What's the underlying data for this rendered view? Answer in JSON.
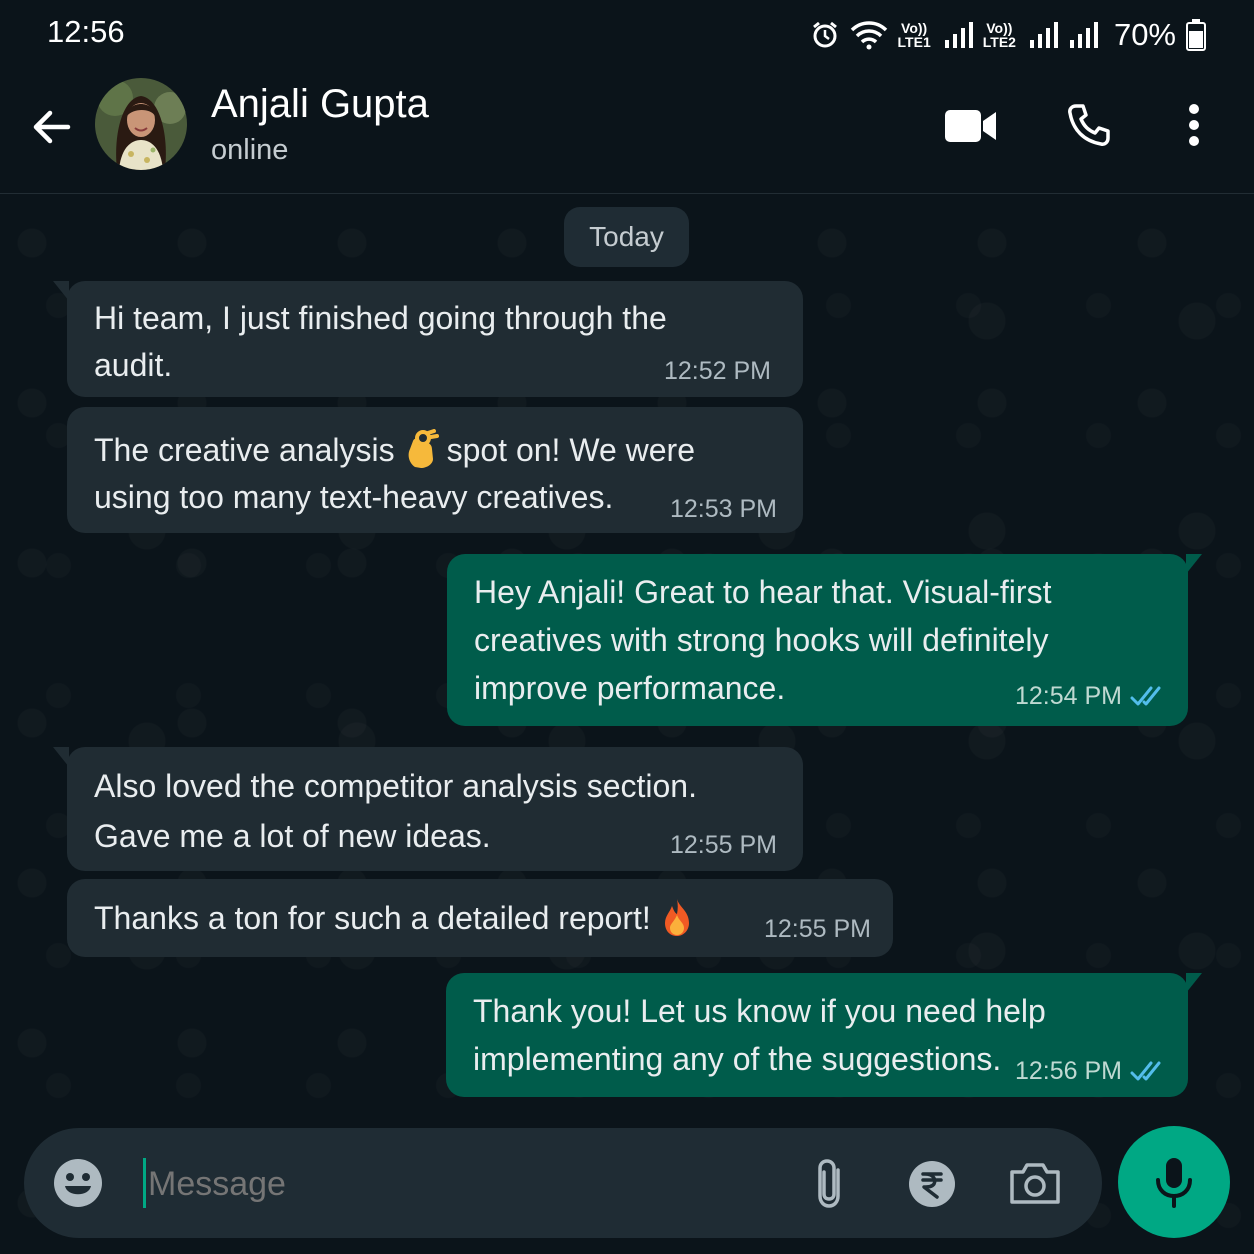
{
  "status_bar": {
    "time": "12:56",
    "net1": {
      "top": "Vo))",
      "bottom": "LTE1"
    },
    "net2": {
      "top": "Vo))",
      "bottom": "LTE2"
    },
    "battery": "70%",
    "icons": [
      "alarm-icon",
      "wifi-icon",
      "signal-icon",
      "signal-icon",
      "signal-icon",
      "battery-icon"
    ]
  },
  "header": {
    "contact_name": "Anjali Gupta",
    "status": "online",
    "icons": [
      "back-arrow-icon",
      "video-call-icon",
      "voice-call-icon",
      "more-options-icon"
    ]
  },
  "chat": {
    "date_divider": "Today",
    "messages": [
      {
        "direction": "incoming",
        "lines": [
          "Hi team, I just finished going through the",
          "audit."
        ],
        "time": "12:52 PM"
      },
      {
        "direction": "incoming",
        "line1_before": "The creative analysis",
        "line1_emoji": "ok-hand",
        "line1_after": "spot on! We were",
        "line2": "using too many text-heavy creatives.",
        "time": "12:53 PM"
      },
      {
        "direction": "outgoing",
        "lines": [
          "Hey Anjali! Great to hear that. Visual-first",
          "creatives with strong hooks will definitely",
          "improve performance."
        ],
        "time": "12:54 PM",
        "read": true
      },
      {
        "direction": "incoming",
        "lines": [
          "Also loved the competitor analysis section.",
          "Gave me a lot of new ideas."
        ],
        "time": "12:55 PM"
      },
      {
        "direction": "incoming",
        "line1_before": "Thanks a ton for such a detailed report!",
        "line1_emoji": "fire",
        "time": "12:55 PM"
      },
      {
        "direction": "outgoing",
        "lines": [
          "Thank you! Let us know if you need help",
          "implementing any of the suggestions."
        ],
        "time": "12:56 PM",
        "read": true
      }
    ]
  },
  "composer": {
    "placeholder": "Message",
    "icons": [
      "emoji-icon",
      "attach-icon",
      "rupee-payment-icon",
      "camera-icon",
      "mic-icon"
    ]
  },
  "colors": {
    "background": "#0b141a",
    "incoming_bubble": "#202c33",
    "outgoing_bubble": "#005c4b",
    "accent": "#00a884",
    "read_ticks": "#53bdeb"
  }
}
